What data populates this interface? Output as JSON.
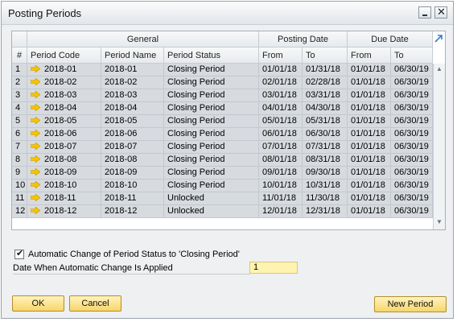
{
  "window": {
    "title": "Posting Periods"
  },
  "title_buttons": {
    "minimize_icon": "minimize-icon",
    "close_glyph": "✕"
  },
  "grid": {
    "group_headers": {
      "rownum": "",
      "general": "General",
      "posting_date": "Posting Date",
      "due_date": "Due Date"
    },
    "columns": [
      "#",
      "Period Code",
      "Period Name",
      "Period Status",
      "From",
      "To",
      "From",
      "To"
    ],
    "rows": [
      [
        "1",
        "2018-01",
        "2018-01",
        "Closing Period",
        "01/01/18",
        "01/31/18",
        "01/01/18",
        "06/30/19"
      ],
      [
        "2",
        "2018-02",
        "2018-02",
        "Closing Period",
        "02/01/18",
        "02/28/18",
        "01/01/18",
        "06/30/19"
      ],
      [
        "3",
        "2018-03",
        "2018-03",
        "Closing Period",
        "03/01/18",
        "03/31/18",
        "01/01/18",
        "06/30/19"
      ],
      [
        "4",
        "2018-04",
        "2018-04",
        "Closing Period",
        "04/01/18",
        "04/30/18",
        "01/01/18",
        "06/30/19"
      ],
      [
        "5",
        "2018-05",
        "2018-05",
        "Closing Period",
        "05/01/18",
        "05/31/18",
        "01/01/18",
        "06/30/19"
      ],
      [
        "6",
        "2018-06",
        "2018-06",
        "Closing Period",
        "06/01/18",
        "06/30/18",
        "01/01/18",
        "06/30/19"
      ],
      [
        "7",
        "2018-07",
        "2018-07",
        "Closing Period",
        "07/01/18",
        "07/31/18",
        "01/01/18",
        "06/30/19"
      ],
      [
        "8",
        "2018-08",
        "2018-08",
        "Closing Period",
        "08/01/18",
        "08/31/18",
        "01/01/18",
        "06/30/19"
      ],
      [
        "9",
        "2018-09",
        "2018-09",
        "Closing Period",
        "09/01/18",
        "09/30/18",
        "01/01/18",
        "06/30/19"
      ],
      [
        "10",
        "2018-10",
        "2018-10",
        "Closing Period",
        "10/01/18",
        "10/31/18",
        "01/01/18",
        "06/30/19"
      ],
      [
        "11",
        "2018-11",
        "2018-11",
        "Unlocked",
        "11/01/18",
        "11/30/18",
        "01/01/18",
        "06/30/19"
      ],
      [
        "12",
        "2018-12",
        "2018-12",
        "Unlocked",
        "12/01/18",
        "12/31/18",
        "01/01/18",
        "06/30/19"
      ]
    ],
    "link_arrow_icon": "link-arrow-icon",
    "expand_icon": "expand-icon"
  },
  "options": {
    "auto_change_label": "Automatic Change of Period Status to 'Closing Period'",
    "auto_change_checked": true,
    "check_glyph": "✔",
    "date_applied_label": "Date When Automatic Change Is Applied",
    "date_applied_value": "1"
  },
  "buttons": {
    "ok": "OK",
    "cancel": "Cancel",
    "new_period": "New Period"
  },
  "colors": {
    "button_fill": "#f7d56a",
    "input_fill": "#fff3b0",
    "row_fill": "#d7dbdf",
    "arrow": "#f5c400"
  }
}
